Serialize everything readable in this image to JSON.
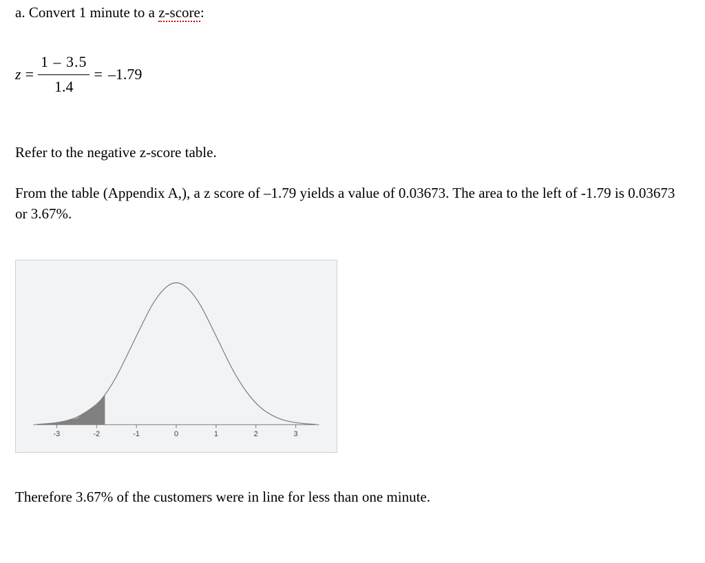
{
  "heading": {
    "prefix": "a. Convert 1 minute to a ",
    "zscore_text": "z-score",
    "suffix": ":"
  },
  "equation": {
    "var": "z",
    "eq1": "=",
    "numerator": "1 – 3.5",
    "denominator": "1.4",
    "eq2": "=",
    "result": "–1.79"
  },
  "para1": "Refer to the negative z-score table.",
  "para2": "From the table (Appendix A,), a z score of –1.79 yields a value of 0.03673.  The area to the left of -1.79 is   0.03673 or 3.67%.",
  "conclusion": "Therefore 3.67% of the customers were in line for less than one minute.",
  "chart_data": {
    "type": "area",
    "title": "",
    "xlabel": "",
    "ylabel": "",
    "xlim": [
      -3.5,
      3.5
    ],
    "ylim": [
      0,
      0.42
    ],
    "ticks": [
      -3,
      -2,
      -1,
      0,
      1,
      2,
      3
    ],
    "shaded_region": {
      "from": -3.5,
      "to": -1.79
    },
    "series": [
      {
        "name": "standard_normal_pdf",
        "x": [
          -3.5,
          -3.0,
          -2.5,
          -2.0,
          -1.79,
          -1.5,
          -1.0,
          -0.5,
          0.0,
          0.5,
          1.0,
          1.5,
          2.0,
          2.5,
          3.0,
          3.5
        ],
        "y": [
          0.0009,
          0.0044,
          0.0175,
          0.054,
          0.0804,
          0.1295,
          0.242,
          0.3521,
          0.3989,
          0.3521,
          0.242,
          0.1295,
          0.054,
          0.0175,
          0.0044,
          0.0009
        ]
      }
    ]
  }
}
